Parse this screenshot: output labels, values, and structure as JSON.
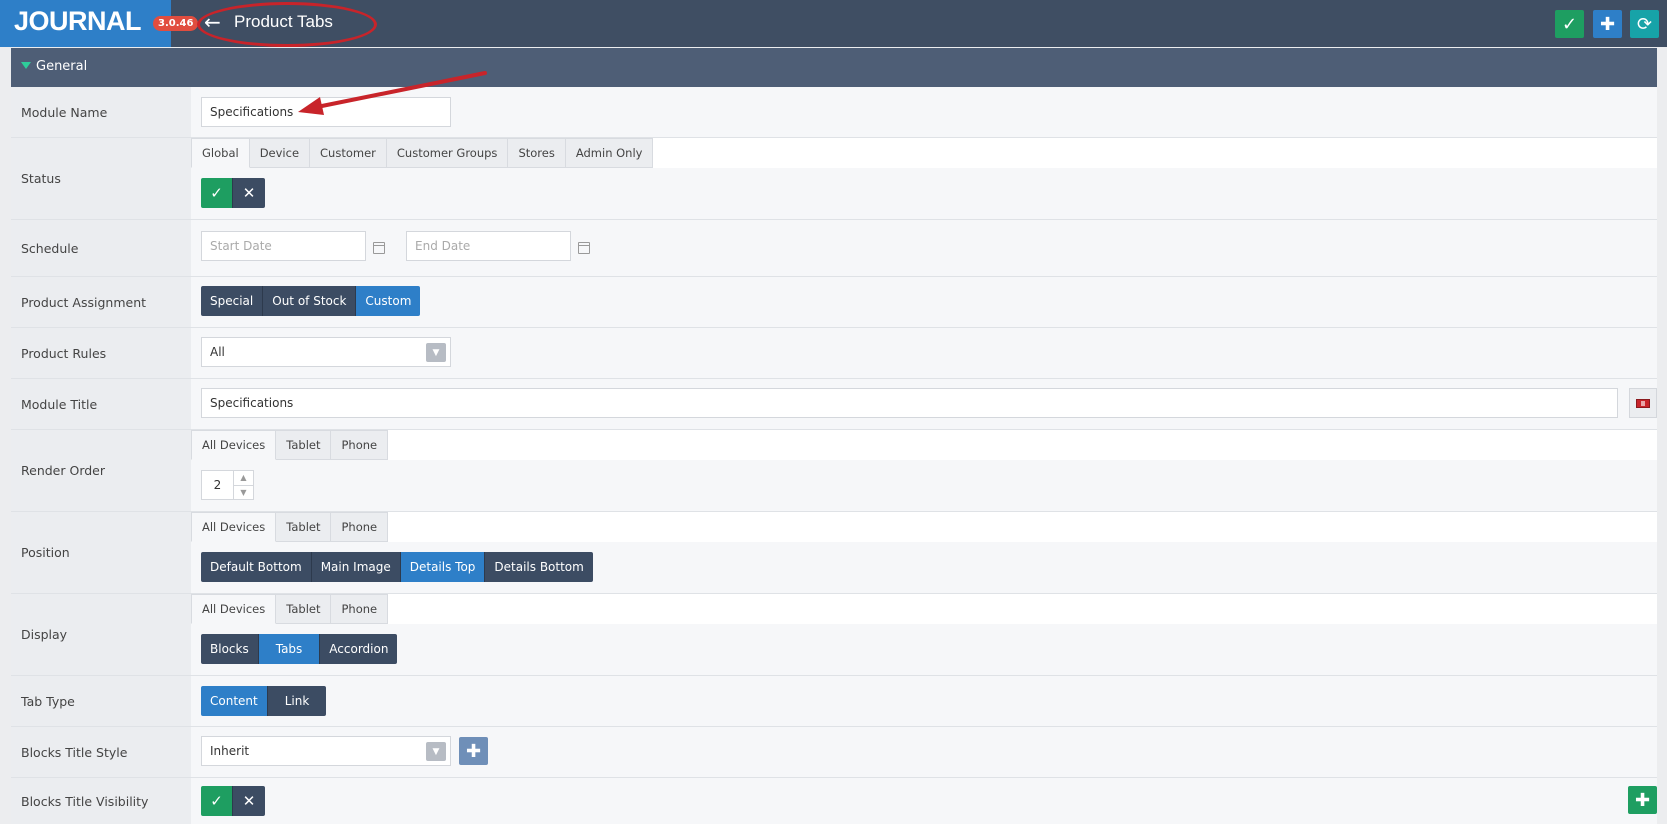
{
  "header": {
    "logo": "JOURNAL",
    "version": "3.0.46",
    "back_icon": "arrow-left-icon",
    "title": "Product Tabs",
    "actions": [
      {
        "name": "save-button",
        "icon": "check-icon",
        "color": "#1e9e61"
      },
      {
        "name": "add-button",
        "icon": "plus-icon",
        "color": "#2e7fc8"
      },
      {
        "name": "history-button",
        "icon": "history-icon",
        "color": "#17a3a8"
      }
    ]
  },
  "section": {
    "label": "General"
  },
  "form": {
    "module_name": {
      "label": "Module Name",
      "value": "Specifications"
    },
    "status": {
      "label": "Status",
      "tabs": [
        "Global",
        "Device",
        "Customer",
        "Customer Groups",
        "Stores",
        "Admin Only"
      ],
      "active_tab": "Global",
      "value": "yes"
    },
    "schedule": {
      "label": "Schedule",
      "start_placeholder": "Start Date",
      "end_placeholder": "End Date"
    },
    "product_assignment": {
      "label": "Product Assignment",
      "options": [
        "Special",
        "Out of Stock",
        "Custom"
      ],
      "selected": "Custom"
    },
    "product_rules": {
      "label": "Product Rules",
      "value": "All"
    },
    "module_title": {
      "label": "Module Title",
      "value": "Specifications"
    },
    "render_order": {
      "label": "Render Order",
      "tabs": [
        "All Devices",
        "Tablet",
        "Phone"
      ],
      "active_tab": "All Devices",
      "value": "2"
    },
    "position": {
      "label": "Position",
      "tabs": [
        "All Devices",
        "Tablet",
        "Phone"
      ],
      "active_tab": "All Devices",
      "options": [
        "Default Bottom",
        "Main Image",
        "Details Top",
        "Details Bottom"
      ],
      "selected": "Details Top"
    },
    "display": {
      "label": "Display",
      "tabs": [
        "All Devices",
        "Tablet",
        "Phone"
      ],
      "active_tab": "All Devices",
      "options": [
        "Blocks",
        "Tabs",
        "Accordion"
      ],
      "selected": "Tabs"
    },
    "tab_type": {
      "label": "Tab Type",
      "options": [
        "Content",
        "Link"
      ],
      "selected": "Content"
    },
    "blocks_title_style": {
      "label": "Blocks Title Style",
      "value": "Inherit"
    },
    "blocks_title_visibility": {
      "label": "Blocks Title Visibility",
      "value": "yes"
    }
  },
  "colors": {
    "accent": "#2e7fc8",
    "success": "#1e9e61",
    "dark": "#3c4c63",
    "annotation": "#c8242a"
  }
}
